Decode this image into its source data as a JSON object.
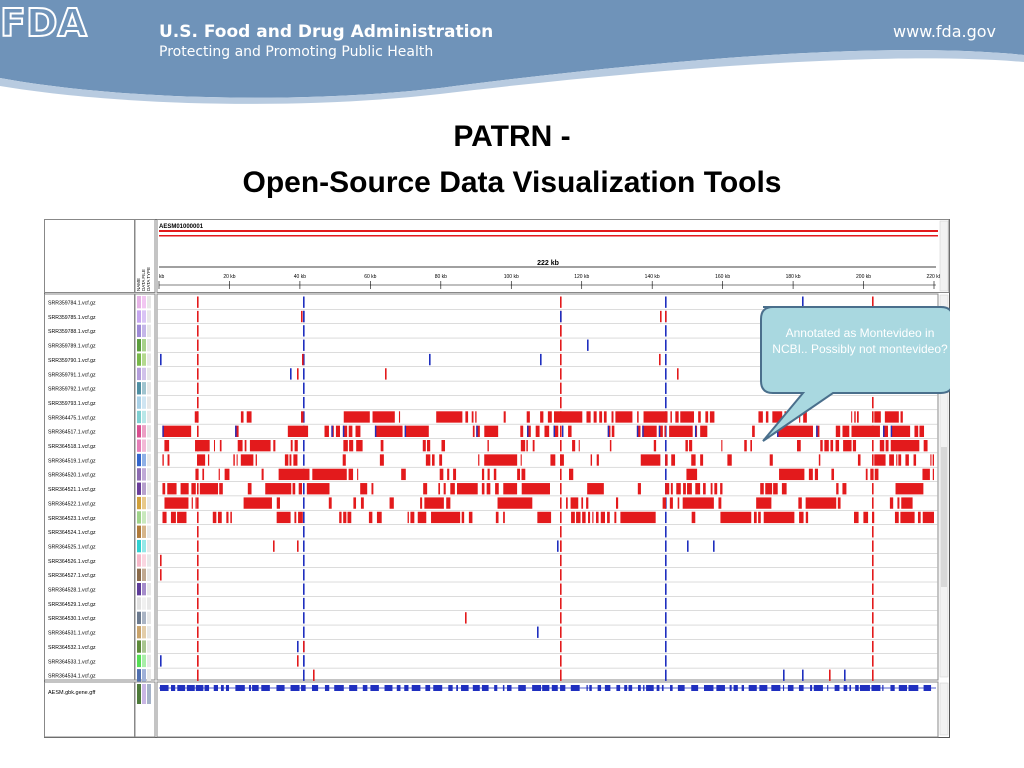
{
  "header": {
    "logo_text": "FDA",
    "org_name": "U.S. Food and Drug Administration",
    "tagline": "Protecting and Promoting Public Health",
    "url": "www.fda.gov"
  },
  "slide": {
    "title_line1": "PATRN -",
    "title_line2": "Open-Source Data Visualization Tools"
  },
  "igv": {
    "locus": "AESM01000001",
    "span_label": "222 kb",
    "ruler_ticks": [
      "kb",
      "20 kb",
      "40 kb",
      "60 kb",
      "80 kb",
      "100 kb",
      "120 kb",
      "140 kb",
      "160 kb",
      "180 kb",
      "200 kb",
      "220 kb"
    ],
    "attribute_headers": [
      "NAME",
      "DATA FILE",
      "DATA TYPE"
    ],
    "tracks": [
      "SRR359784.1.vcf.gz",
      "SRR359785.1.vcf.gz",
      "SRR359788.1.vcf.gz",
      "SRR359789.1.vcf.gz",
      "SRR359790.1.vcf.gz",
      "SRR359791.1.vcf.gz",
      "SRR359792.1.vcf.gz",
      "SRR359793.1.vcf.gz",
      "SRR364475.1.vcf.gz",
      "SRR364517.1.vcf.gz",
      "SRR364518.1.vcf.gz",
      "SRR364519.1.vcf.gz",
      "SRR364520.1.vcf.gz",
      "SRR364521.1.vcf.gz",
      "SRR364522.1.vcf.gz",
      "SRR364523.1.vcf.gz",
      "SRR364524.1.vcf.gz",
      "SRR364525.1.vcf.gz",
      "SRR364526.1.vcf.gz",
      "SRR364527.1.vcf.gz",
      "SRR364528.1.vcf.gz",
      "SRR364529.1.vcf.gz",
      "SRR364530.1.vcf.gz",
      "SRR364531.1.vcf.gz",
      "SRR364532.1.vcf.gz",
      "SRR364533.1.vcf.gz",
      "SRR364534.1.vcf.gz"
    ],
    "gene_track": "AESM.gbk.gene.gff"
  },
  "callout": {
    "text": "Annotated as Montevideo in NCBI.. Possibly not montevideo?"
  },
  "colors": {
    "banner": "#6f93b9",
    "variant_red": "#e31a1c",
    "variant_blue": "#1f2fbf",
    "callout_fill": "#a9d8e0",
    "callout_border": "#4a6f8c"
  }
}
